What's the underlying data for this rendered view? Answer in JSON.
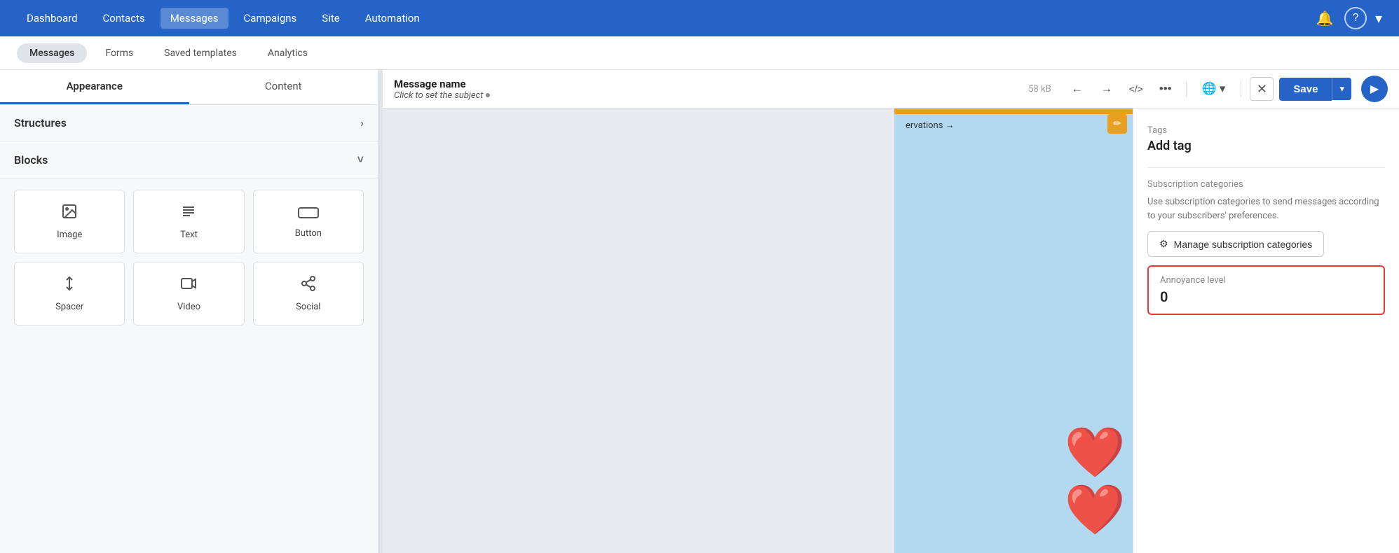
{
  "topNav": {
    "links": [
      {
        "label": "Dashboard",
        "active": false
      },
      {
        "label": "Contacts",
        "active": false
      },
      {
        "label": "Messages",
        "active": true
      },
      {
        "label": "Campaigns",
        "active": false
      },
      {
        "label": "Site",
        "active": false
      },
      {
        "label": "Automation",
        "active": false
      }
    ],
    "icons": {
      "bell": "🔔",
      "help": "?",
      "dropdown": "▾"
    }
  },
  "subNav": {
    "items": [
      {
        "label": "Messages",
        "active": true
      },
      {
        "label": "Forms",
        "active": false
      },
      {
        "label": "Saved templates",
        "active": false
      },
      {
        "label": "Analytics",
        "active": false
      }
    ]
  },
  "leftPanel": {
    "tabs": [
      {
        "label": "Appearance",
        "active": true
      },
      {
        "label": "Content",
        "active": false
      }
    ],
    "structures": {
      "label": "Structures",
      "chevron": "›"
    },
    "blocks": {
      "label": "Blocks",
      "chevron": "˅",
      "items": [
        {
          "name": "Image",
          "icon": "🖼"
        },
        {
          "name": "Text",
          "icon": "≡"
        },
        {
          "name": "Button",
          "icon": "▭"
        },
        {
          "name": "Spacer",
          "icon": "↕"
        },
        {
          "name": "Video",
          "icon": "▶"
        },
        {
          "name": "Social",
          "icon": "◁"
        }
      ]
    }
  },
  "editorToolbar": {
    "messageName": "Message name",
    "subject": "Click to set the subject",
    "subjectDot": "•",
    "size": "58 kB",
    "buttons": {
      "undo": "←",
      "redo": "→",
      "code": "</>",
      "more": "•••",
      "lang": "🌐",
      "langChevron": "▾",
      "close": "✕",
      "save": "Save",
      "saveDropdown": "▾",
      "play": "▶"
    }
  },
  "settingsSidebar": {
    "tagsLabel": "Tags",
    "tagsValue": "Add tag",
    "subscriptionLabel": "Subscription categories",
    "subscriptionDesc": "Use subscription categories to send messages according to your subscribers' preferences.",
    "manageBtn": "Manage subscription categories",
    "manageBtnIcon": "⚙",
    "annoyanceLabel": "Annoyance level",
    "annoyanceValue": "0"
  },
  "preview": {
    "reservationsText": "ervations →",
    "hearts": "❤"
  }
}
